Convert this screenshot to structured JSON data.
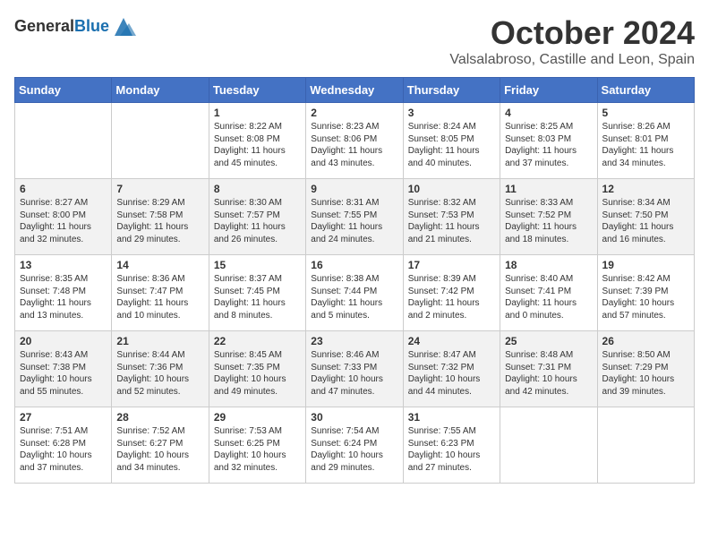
{
  "header": {
    "logo_line1": "General",
    "logo_line2": "Blue",
    "title": "October 2024",
    "subtitle": "Valsalabroso, Castille and Leon, Spain"
  },
  "weekdays": [
    "Sunday",
    "Monday",
    "Tuesday",
    "Wednesday",
    "Thursday",
    "Friday",
    "Saturday"
  ],
  "weeks": [
    [
      {
        "day": "",
        "content": ""
      },
      {
        "day": "",
        "content": ""
      },
      {
        "day": "1",
        "content": "Sunrise: 8:22 AM\nSunset: 8:08 PM\nDaylight: 11 hours and 45 minutes."
      },
      {
        "day": "2",
        "content": "Sunrise: 8:23 AM\nSunset: 8:06 PM\nDaylight: 11 hours and 43 minutes."
      },
      {
        "day": "3",
        "content": "Sunrise: 8:24 AM\nSunset: 8:05 PM\nDaylight: 11 hours and 40 minutes."
      },
      {
        "day": "4",
        "content": "Sunrise: 8:25 AM\nSunset: 8:03 PM\nDaylight: 11 hours and 37 minutes."
      },
      {
        "day": "5",
        "content": "Sunrise: 8:26 AM\nSunset: 8:01 PM\nDaylight: 11 hours and 34 minutes."
      }
    ],
    [
      {
        "day": "6",
        "content": "Sunrise: 8:27 AM\nSunset: 8:00 PM\nDaylight: 11 hours and 32 minutes."
      },
      {
        "day": "7",
        "content": "Sunrise: 8:29 AM\nSunset: 7:58 PM\nDaylight: 11 hours and 29 minutes."
      },
      {
        "day": "8",
        "content": "Sunrise: 8:30 AM\nSunset: 7:57 PM\nDaylight: 11 hours and 26 minutes."
      },
      {
        "day": "9",
        "content": "Sunrise: 8:31 AM\nSunset: 7:55 PM\nDaylight: 11 hours and 24 minutes."
      },
      {
        "day": "10",
        "content": "Sunrise: 8:32 AM\nSunset: 7:53 PM\nDaylight: 11 hours and 21 minutes."
      },
      {
        "day": "11",
        "content": "Sunrise: 8:33 AM\nSunset: 7:52 PM\nDaylight: 11 hours and 18 minutes."
      },
      {
        "day": "12",
        "content": "Sunrise: 8:34 AM\nSunset: 7:50 PM\nDaylight: 11 hours and 16 minutes."
      }
    ],
    [
      {
        "day": "13",
        "content": "Sunrise: 8:35 AM\nSunset: 7:48 PM\nDaylight: 11 hours and 13 minutes."
      },
      {
        "day": "14",
        "content": "Sunrise: 8:36 AM\nSunset: 7:47 PM\nDaylight: 11 hours and 10 minutes."
      },
      {
        "day": "15",
        "content": "Sunrise: 8:37 AM\nSunset: 7:45 PM\nDaylight: 11 hours and 8 minutes."
      },
      {
        "day": "16",
        "content": "Sunrise: 8:38 AM\nSunset: 7:44 PM\nDaylight: 11 hours and 5 minutes."
      },
      {
        "day": "17",
        "content": "Sunrise: 8:39 AM\nSunset: 7:42 PM\nDaylight: 11 hours and 2 minutes."
      },
      {
        "day": "18",
        "content": "Sunrise: 8:40 AM\nSunset: 7:41 PM\nDaylight: 11 hours and 0 minutes."
      },
      {
        "day": "19",
        "content": "Sunrise: 8:42 AM\nSunset: 7:39 PM\nDaylight: 10 hours and 57 minutes."
      }
    ],
    [
      {
        "day": "20",
        "content": "Sunrise: 8:43 AM\nSunset: 7:38 PM\nDaylight: 10 hours and 55 minutes."
      },
      {
        "day": "21",
        "content": "Sunrise: 8:44 AM\nSunset: 7:36 PM\nDaylight: 10 hours and 52 minutes."
      },
      {
        "day": "22",
        "content": "Sunrise: 8:45 AM\nSunset: 7:35 PM\nDaylight: 10 hours and 49 minutes."
      },
      {
        "day": "23",
        "content": "Sunrise: 8:46 AM\nSunset: 7:33 PM\nDaylight: 10 hours and 47 minutes."
      },
      {
        "day": "24",
        "content": "Sunrise: 8:47 AM\nSunset: 7:32 PM\nDaylight: 10 hours and 44 minutes."
      },
      {
        "day": "25",
        "content": "Sunrise: 8:48 AM\nSunset: 7:31 PM\nDaylight: 10 hours and 42 minutes."
      },
      {
        "day": "26",
        "content": "Sunrise: 8:50 AM\nSunset: 7:29 PM\nDaylight: 10 hours and 39 minutes."
      }
    ],
    [
      {
        "day": "27",
        "content": "Sunrise: 7:51 AM\nSunset: 6:28 PM\nDaylight: 10 hours and 37 minutes."
      },
      {
        "day": "28",
        "content": "Sunrise: 7:52 AM\nSunset: 6:27 PM\nDaylight: 10 hours and 34 minutes."
      },
      {
        "day": "29",
        "content": "Sunrise: 7:53 AM\nSunset: 6:25 PM\nDaylight: 10 hours and 32 minutes."
      },
      {
        "day": "30",
        "content": "Sunrise: 7:54 AM\nSunset: 6:24 PM\nDaylight: 10 hours and 29 minutes."
      },
      {
        "day": "31",
        "content": "Sunrise: 7:55 AM\nSunset: 6:23 PM\nDaylight: 10 hours and 27 minutes."
      },
      {
        "day": "",
        "content": ""
      },
      {
        "day": "",
        "content": ""
      }
    ]
  ]
}
